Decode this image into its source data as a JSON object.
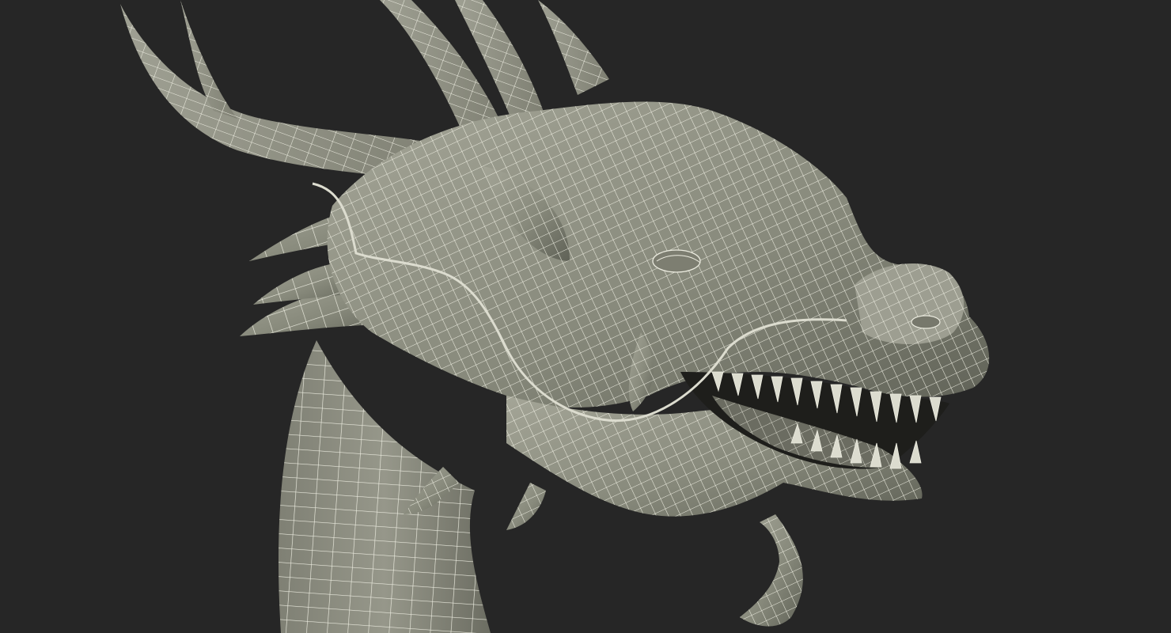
{
  "scene": {
    "subject": "dragon-head-wireframe-render",
    "view": "perspective",
    "colors": {
      "background": "#262626",
      "surface": "#8a8b7d",
      "surface_light": "#a9aa9d",
      "surface_shadow": "#5b5c52",
      "wire": "#e8e8dc",
      "mouth": "#1d1d1a",
      "teeth": "#dcdccf"
    }
  }
}
